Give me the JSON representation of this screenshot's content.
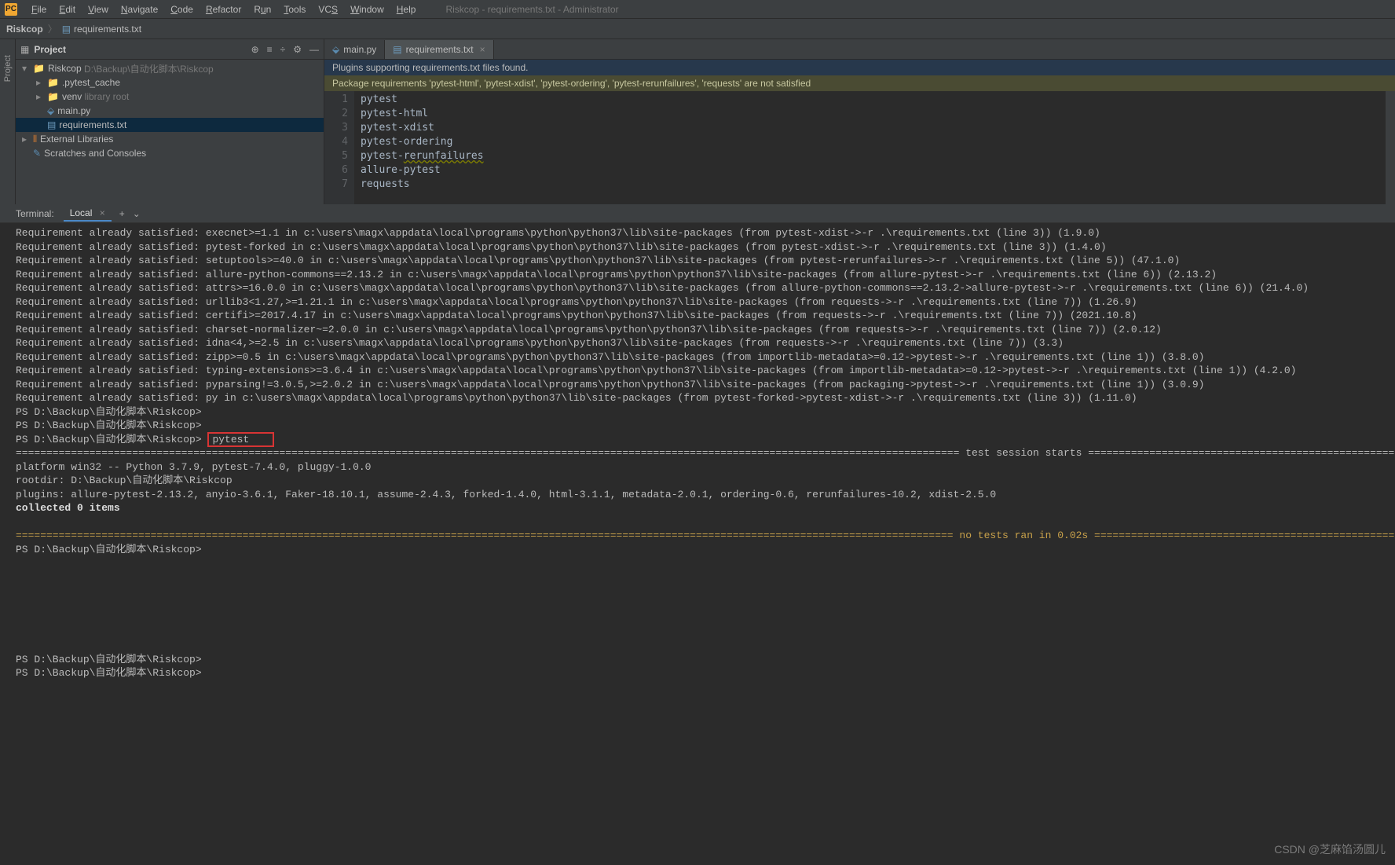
{
  "menubar": {
    "items": [
      "File",
      "Edit",
      "View",
      "Navigate",
      "Code",
      "Refactor",
      "Run",
      "Tools",
      "VCS",
      "Window",
      "Help"
    ],
    "title": "Riskcop - requirements.txt - Administrator"
  },
  "breadcrumb": {
    "root": "Riskcop",
    "file": "requirements.txt"
  },
  "sidebarStripLabel": "Project",
  "projectPanel": {
    "title": "Project",
    "tree": [
      {
        "indent": 0,
        "arrow": "▾",
        "icon": "folder",
        "label": "Riskcop",
        "suffix": "D:\\Backup\\自动化脚本\\Riskcop",
        "selected": false
      },
      {
        "indent": 1,
        "arrow": "▸",
        "icon": "folder",
        "label": ".pytest_cache",
        "suffix": "",
        "selected": false
      },
      {
        "indent": 1,
        "arrow": "▸",
        "icon": "folder",
        "label": "venv",
        "suffix": "library root",
        "libcolor": true,
        "selected": false
      },
      {
        "indent": 1,
        "arrow": "",
        "icon": "pyfile",
        "label": "main.py",
        "suffix": "",
        "selected": false
      },
      {
        "indent": 1,
        "arrow": "",
        "icon": "txtfile",
        "label": "requirements.txt",
        "suffix": "",
        "selected": true
      },
      {
        "indent": 0,
        "arrow": "▸",
        "icon": "lib",
        "label": "External Libraries",
        "suffix": "",
        "selected": false
      },
      {
        "indent": 0,
        "arrow": "",
        "icon": "scratch",
        "label": "Scratches and Consoles",
        "suffix": "",
        "selected": false
      }
    ]
  },
  "tabs": [
    {
      "icon": "py",
      "label": "main.py",
      "active": false
    },
    {
      "icon": "txt",
      "label": "requirements.txt",
      "active": true
    }
  ],
  "banner1": "Plugins supporting requirements.txt files found.",
  "banner2": "Package requirements 'pytest-html', 'pytest-xdist', 'pytest-ordering', 'pytest-rerunfailures', 'requests' are not satisfied",
  "editorLines": [
    "pytest",
    "pytest-html",
    "pytest-xdist",
    "pytest-ordering",
    "pytest-rerunfailures",
    "allure-pytest",
    "requests"
  ],
  "terminal": {
    "title": "Terminal:",
    "tabLabel": "Local",
    "lines": [
      "Requirement already satisfied: execnet>=1.1 in c:\\users\\magx\\appdata\\local\\programs\\python\\python37\\lib\\site-packages (from pytest-xdist->-r .\\requirements.txt (line 3)) (1.9.0)",
      "Requirement already satisfied: pytest-forked in c:\\users\\magx\\appdata\\local\\programs\\python\\python37\\lib\\site-packages (from pytest-xdist->-r .\\requirements.txt (line 3)) (1.4.0)",
      "Requirement already satisfied: setuptools>=40.0 in c:\\users\\magx\\appdata\\local\\programs\\python\\python37\\lib\\site-packages (from pytest-rerunfailures->-r .\\requirements.txt (line 5)) (47.1.0)",
      "Requirement already satisfied: allure-python-commons==2.13.2 in c:\\users\\magx\\appdata\\local\\programs\\python\\python37\\lib\\site-packages (from allure-pytest->-r .\\requirements.txt (line 6)) (2.13.2)",
      "Requirement already satisfied: attrs>=16.0.0 in c:\\users\\magx\\appdata\\local\\programs\\python\\python37\\lib\\site-packages (from allure-python-commons==2.13.2->allure-pytest->-r .\\requirements.txt (line 6)) (21.4.0)",
      "Requirement already satisfied: urllib3<1.27,>=1.21.1 in c:\\users\\magx\\appdata\\local\\programs\\python\\python37\\lib\\site-packages (from requests->-r .\\requirements.txt (line 7)) (1.26.9)",
      "Requirement already satisfied: certifi>=2017.4.17 in c:\\users\\magx\\appdata\\local\\programs\\python\\python37\\lib\\site-packages (from requests->-r .\\requirements.txt (line 7)) (2021.10.8)",
      "Requirement already satisfied: charset-normalizer~=2.0.0 in c:\\users\\magx\\appdata\\local\\programs\\python\\python37\\lib\\site-packages (from requests->-r .\\requirements.txt (line 7)) (2.0.12)",
      "Requirement already satisfied: idna<4,>=2.5 in c:\\users\\magx\\appdata\\local\\programs\\python\\python37\\lib\\site-packages (from requests->-r .\\requirements.txt (line 7)) (3.3)",
      "Requirement already satisfied: zipp>=0.5 in c:\\users\\magx\\appdata\\local\\programs\\python\\python37\\lib\\site-packages (from importlib-metadata>=0.12->pytest->-r .\\requirements.txt (line 1)) (3.8.0)",
      "Requirement already satisfied: typing-extensions>=3.6.4 in c:\\users\\magx\\appdata\\local\\programs\\python\\python37\\lib\\site-packages (from importlib-metadata>=0.12->pytest->-r .\\requirements.txt (line 1)) (4.2.0)",
      "Requirement already satisfied: pyparsing!=3.0.5,>=2.0.2 in c:\\users\\magx\\appdata\\local\\programs\\python\\python37\\lib\\site-packages (from packaging->pytest->-r .\\requirements.txt (line 1)) (3.0.9)",
      "Requirement already satisfied: py in c:\\users\\magx\\appdata\\local\\programs\\python\\python37\\lib\\site-packages (from pytest-forked->pytest-xdist->-r .\\requirements.txt (line 3)) (1.11.0)"
    ],
    "psPrompt": "PS D:\\Backup\\自动化脚本\\Riskcop>",
    "cmdHighlighted": "pytest",
    "sessionHeader": "========================================================================================================================================================== test session starts ===========================================================================================================================================================",
    "platform": "platform win32 -- Python 3.7.9, pytest-7.4.0, pluggy-1.0.0",
    "rootdir": "rootdir: D:\\Backup\\自动化脚本\\Riskcop",
    "plugins": "plugins: allure-pytest-2.13.2, anyio-3.6.1, Faker-18.10.1, assume-2.4.3, forked-1.4.0, html-3.1.1, metadata-2.0.1, ordering-0.6, rerunfailures-10.2, xdist-2.5.0",
    "collected": "collected 0 items",
    "noTests": "========================================================================================================================================================= no tests ran in 0.02s =========================================================================================================================================================="
  },
  "watermark": "CSDN @芝麻馅汤圆儿"
}
